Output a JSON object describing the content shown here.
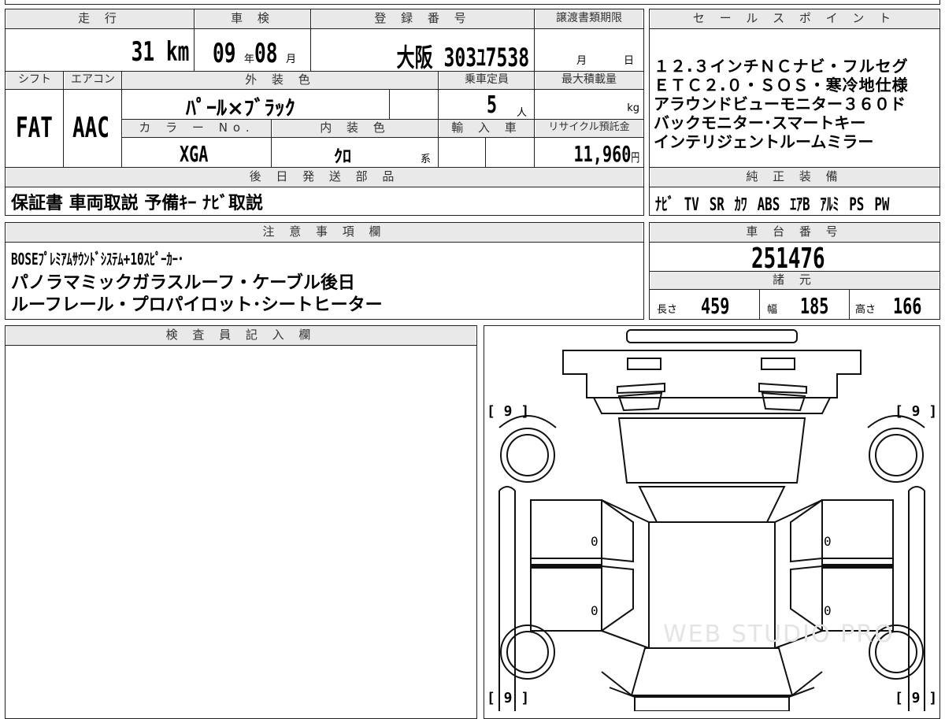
{
  "top_strip_text": "",
  "mileage": {
    "label": "走 行",
    "value": "31",
    "unit": "km"
  },
  "inspection": {
    "label": "車 検",
    "year": "09",
    "year_unit": "年",
    "month": "08",
    "month_unit": "月"
  },
  "registration": {
    "label": "登 録 番 号",
    "value": "大阪 303ﾕ7538"
  },
  "transfer_deadline": {
    "label": "譲渡書類期限",
    "month_unit": "月",
    "day_unit": "日"
  },
  "shift": {
    "label": "シフト",
    "value": "FAT"
  },
  "aircon": {
    "label": "エアコン",
    "value": "AAC"
  },
  "exterior_color": {
    "label": "外 装 色",
    "value": "ﾊﾟｰﾙ×ﾌﾞﾗｯｸ"
  },
  "capacity": {
    "label": "乗車定員",
    "value": "5",
    "unit": "人"
  },
  "max_load": {
    "label": "最大積載量",
    "unit": "kg"
  },
  "color_no": {
    "label": "カ ラ ー No.",
    "value": "XGA"
  },
  "interior_color": {
    "label": "内 装 色",
    "value": "ｸﾛ",
    "suffix": "系"
  },
  "import": {
    "label": "輸 入 車"
  },
  "recycle": {
    "label": "リサイクル預託金",
    "value": "11,960",
    "unit": "円"
  },
  "later_parts": {
    "label": "後 日 発 送 部 品",
    "value": "保証書 車両取説 予備ｷｰ ﾅﾋﾞ取説"
  },
  "sales_points": {
    "label": "セ ー ル ス ポ イ ン ト",
    "lines": [
      "１２.３インチＮＣナビ・フルセグ",
      "ＥＴＣ２.０・ＳＯＳ・寒冷地仕様",
      "アラウンドビューモニター３６０ド",
      "バックモニター･スマートキー",
      "インテリジェントルームミラー"
    ]
  },
  "equipment": {
    "label": "純 正 装 備",
    "items": [
      "ﾅﾋﾞ",
      "TV",
      "SR",
      "ｶﾜ",
      "ABS",
      "ｴｱB",
      "ｱﾙﾐ",
      "PS",
      "PW"
    ]
  },
  "notes": {
    "label": "注 意 事 項 欄",
    "lines": [
      "BOSEﾌﾟﾚﾐｱﾑｻｳﾝﾄﾞｼｽﾃﾑ+10ｽﾋﾟｰｶｰ･",
      "パノラマミックガラスルーフ・ケーブル後日",
      "ルーフレール・プロパイロット･シートヒーター"
    ]
  },
  "chassis": {
    "label": "車 台 番 号",
    "value": "251476"
  },
  "specs": {
    "label": "諸 元",
    "length_label": "長さ",
    "length": "459",
    "width_label": "幅",
    "width": "185",
    "height_label": "高さ",
    "height": "166"
  },
  "inspector": {
    "label": "検 査 員 記 入 欄"
  },
  "diagram": {
    "tire_marks": [
      "[ 9 ]",
      "[ 9 ]",
      "[ 9 ]",
      "[ 9 ]"
    ],
    "door_marks": [
      "0",
      "0",
      "0",
      "0"
    ],
    "watermark": "WEB STUDIO PRO"
  }
}
